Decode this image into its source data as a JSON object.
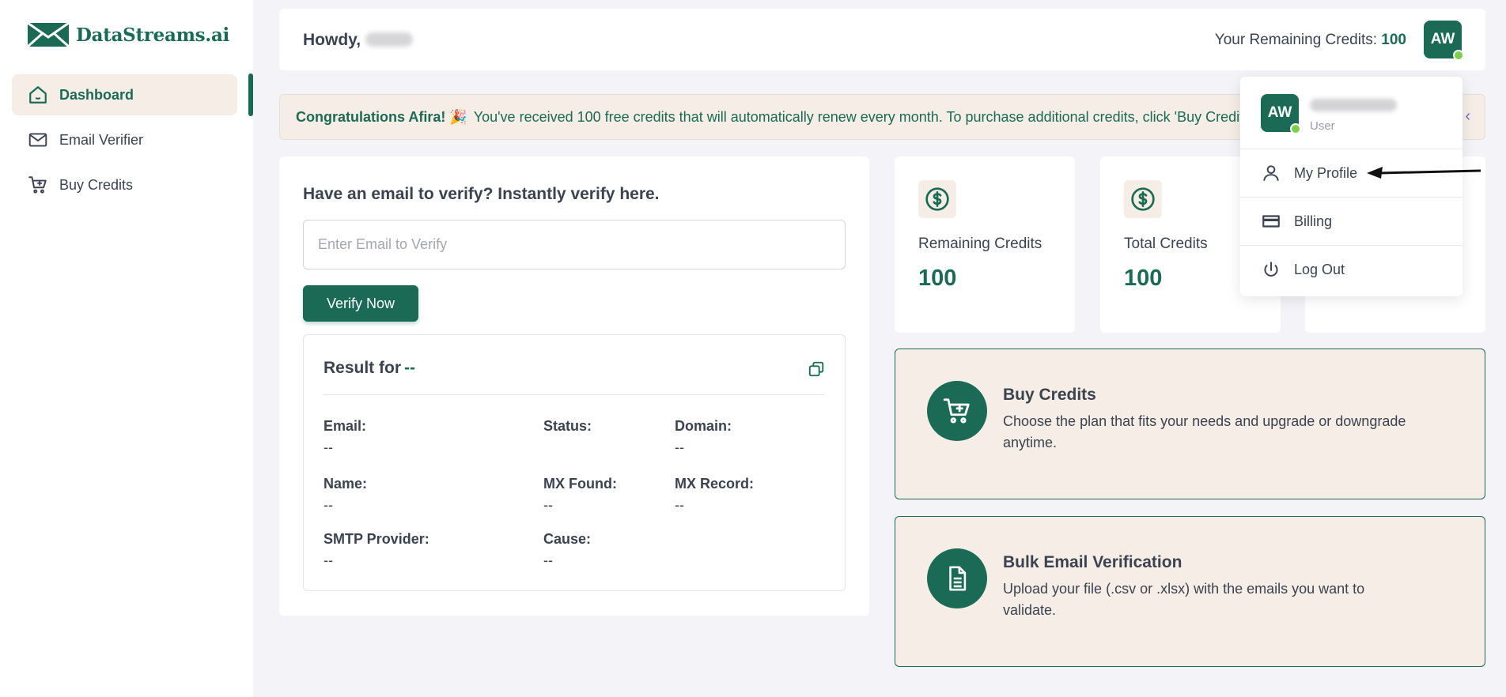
{
  "brand": {
    "name": "DataStreams.ai",
    "logo_icon": "envelope-logo-icon"
  },
  "sidebar": {
    "items": [
      {
        "label": "Dashboard",
        "icon": "home-icon",
        "active": true
      },
      {
        "label": "Email Verifier",
        "icon": "mail-icon",
        "active": false
      },
      {
        "label": "Buy Credits",
        "icon": "cart-plus-icon",
        "active": false
      }
    ]
  },
  "header": {
    "greeting": "Howdy,",
    "credits_label": "Your Remaining Credits:",
    "credits_value": "100",
    "avatar_initials": "AW"
  },
  "banner": {
    "highlight": "Congratulations Afira! 🎉",
    "message": "You've received 100 free credits that will automatically renew every month. To purchase additional credits, click 'Buy Credits'"
  },
  "verify": {
    "title": "Have an email to verify? Instantly verify here.",
    "input_placeholder": "Enter Email to Verify",
    "button_label": "Verify Now",
    "result_label": "Result for",
    "result_target": "--",
    "fields": {
      "email": {
        "label": "Email:",
        "value": "--"
      },
      "status": {
        "label": "Status:",
        "value": ""
      },
      "domain": {
        "label": "Domain:",
        "value": "--"
      },
      "name": {
        "label": "Name:",
        "value": "--"
      },
      "mx_found": {
        "label": "MX Found:",
        "value": "--"
      },
      "mx_record": {
        "label": "MX Record:",
        "value": "--"
      },
      "smtp_provider": {
        "label": "SMTP Provider:",
        "value": "--"
      },
      "cause": {
        "label": "Cause:",
        "value": "--"
      }
    }
  },
  "stats": [
    {
      "label": "Remaining Credits",
      "value": "100",
      "icon": "dollar-circle-icon"
    },
    {
      "label": "Total Credits",
      "value": "100",
      "icon": "dollar-circle-icon"
    }
  ],
  "actions": [
    {
      "title": "Buy Credits",
      "desc": "Choose the plan that fits your needs and upgrade or downgrade anytime.",
      "icon": "cart-plus-icon"
    },
    {
      "title": "Bulk Email Verification",
      "desc": "Upload your file (.csv or .xlsx) with the emails you want to validate.",
      "icon": "document-icon"
    }
  ],
  "dropdown": {
    "avatar_initials": "AW",
    "role": "User",
    "items": [
      {
        "label": "My Profile",
        "icon": "user-icon"
      },
      {
        "label": "Billing",
        "icon": "credit-card-icon"
      },
      {
        "label": "Log Out",
        "icon": "power-icon"
      }
    ]
  },
  "colors": {
    "primary": "#1a6a56",
    "beige": "#f5ede6",
    "background": "#f3f3f8",
    "online": "#7ccf4a"
  }
}
